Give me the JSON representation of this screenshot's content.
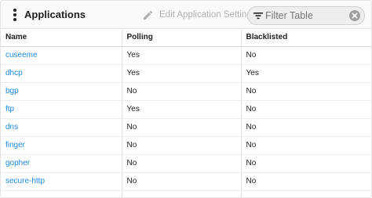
{
  "header": {
    "title": "Applications",
    "edit_label": "Edit Application Settings",
    "filter_placeholder": "Filter Table"
  },
  "table": {
    "columns": [
      "Name",
      "Polling",
      "Blacklisted"
    ],
    "rows": [
      {
        "name": "cuseeme",
        "polling": "Yes",
        "blacklisted": "No"
      },
      {
        "name": "dhcp",
        "polling": "Yes",
        "blacklisted": "Yes"
      },
      {
        "name": "bgp",
        "polling": "No",
        "blacklisted": "No"
      },
      {
        "name": "ftp",
        "polling": "Yes",
        "blacklisted": "No"
      },
      {
        "name": "dns",
        "polling": "No",
        "blacklisted": "No"
      },
      {
        "name": "finger",
        "polling": "No",
        "blacklisted": "No"
      },
      {
        "name": "gopher",
        "polling": "No",
        "blacklisted": "No"
      },
      {
        "name": "secure-http",
        "polling": "No",
        "blacklisted": "No"
      }
    ]
  },
  "icons": {
    "menu": "more-vert-icon",
    "edit": "pencil-icon",
    "filter": "filter-list-icon",
    "clear": "clear-circle-icon"
  },
  "colors": {
    "link": "#1e88e5",
    "toolbar_bg": "#fafafa",
    "disabled_text": "#b0b0b0"
  }
}
